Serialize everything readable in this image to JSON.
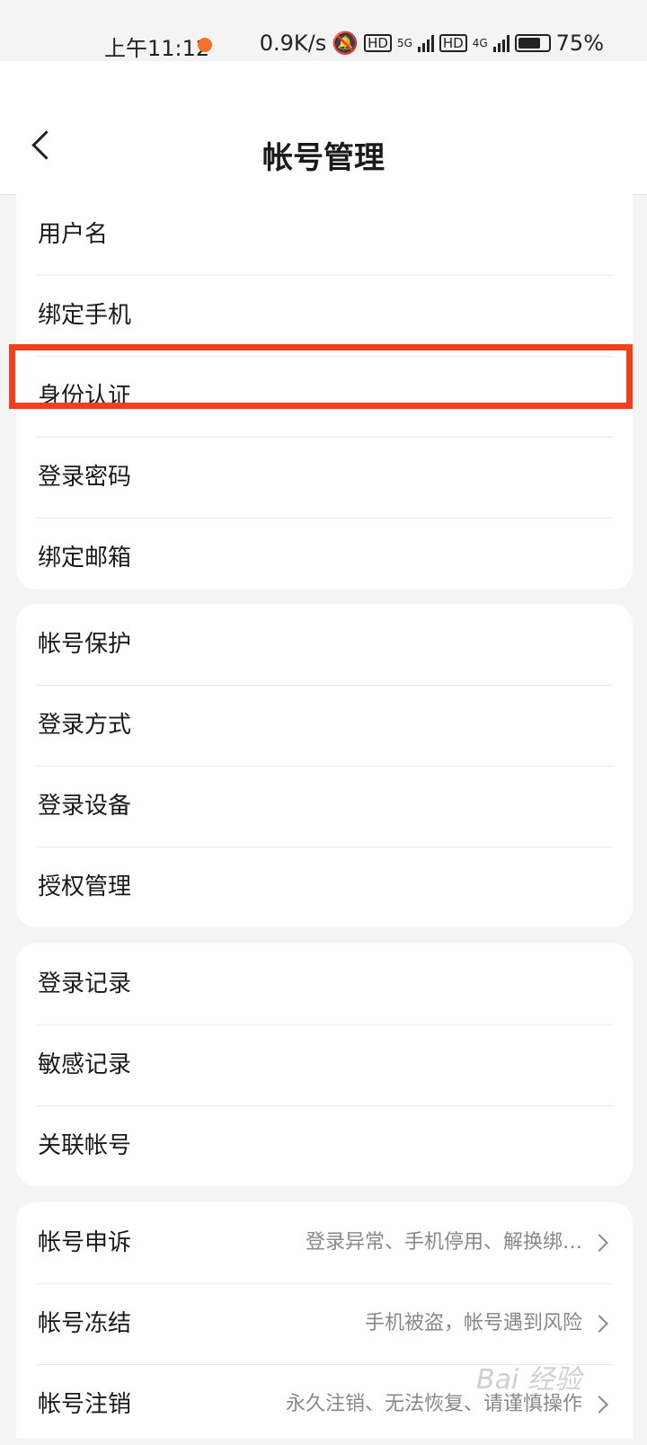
{
  "status_bar": {
    "time": "上午11:12",
    "net_speed": "0.9K/s",
    "hd1": "HD",
    "sig1": "5G",
    "hd2": "HD",
    "sig2": "4G",
    "battery": "75%"
  },
  "header": {
    "title": "帐号管理"
  },
  "group1": [
    {
      "label": "用户名"
    },
    {
      "label": "绑定手机"
    },
    {
      "label": "身份认证"
    },
    {
      "label": "登录密码"
    },
    {
      "label": "绑定邮箱"
    }
  ],
  "group2": [
    {
      "label": "帐号保护"
    },
    {
      "label": "登录方式"
    },
    {
      "label": "登录设备"
    },
    {
      "label": "授权管理"
    }
  ],
  "group3": [
    {
      "label": "登录记录"
    },
    {
      "label": "敏感记录"
    },
    {
      "label": "关联帐号"
    }
  ],
  "group4": [
    {
      "label": "帐号申诉",
      "sub": "登录异常、手机停用、解换绑…"
    },
    {
      "label": "帐号冻结",
      "sub": "手机被盗，帐号遇到风险"
    },
    {
      "label": "帐号注销",
      "sub": "永久注销、无法恢复、请谨慎操作"
    }
  ],
  "watermark": "Bai 经验",
  "colors": {
    "highlight": "#f0401e",
    "accent_dot": "#f7702a"
  }
}
